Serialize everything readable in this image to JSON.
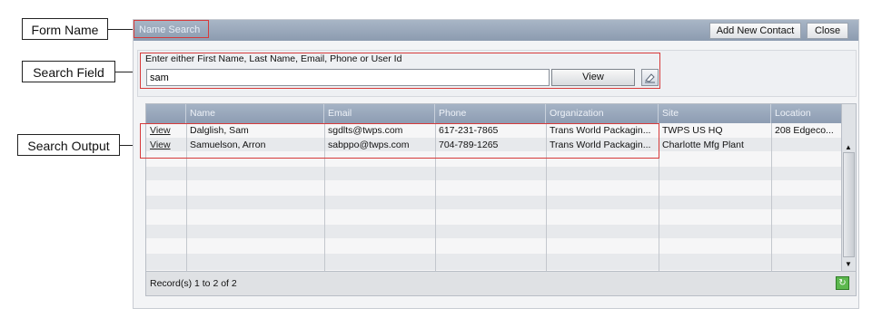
{
  "callouts": {
    "form_name": "Form Name",
    "search_field": "Search Field",
    "search_output": "Search Output"
  },
  "window": {
    "title": "Name Search",
    "add_contact_label": "Add New Contact",
    "close_label": "Close"
  },
  "search": {
    "prompt": "Enter either First Name, Last Name, Email, Phone or User Id",
    "value": "sam",
    "view_label": "View"
  },
  "grid": {
    "columns": [
      "",
      "Name",
      "Email",
      "Phone",
      "Organization",
      "Site",
      "Location"
    ],
    "rows": [
      {
        "link": "View",
        "name": "Dalglish, Sam",
        "email": "sgdlts@twps.com",
        "phone": "617-231-7865",
        "org": "Trans World Packagin...",
        "site": "TWPS US HQ",
        "location": "208 Edgeco..."
      },
      {
        "link": "View",
        "name": "Samuelson, Arron",
        "email": "sabppo@twps.com",
        "phone": "704-789-1265",
        "org": "Trans World Packagin...",
        "site": "Charlotte Mfg Plant",
        "location": ""
      }
    ],
    "record_text": "Record(s) 1 to 2 of 2"
  }
}
